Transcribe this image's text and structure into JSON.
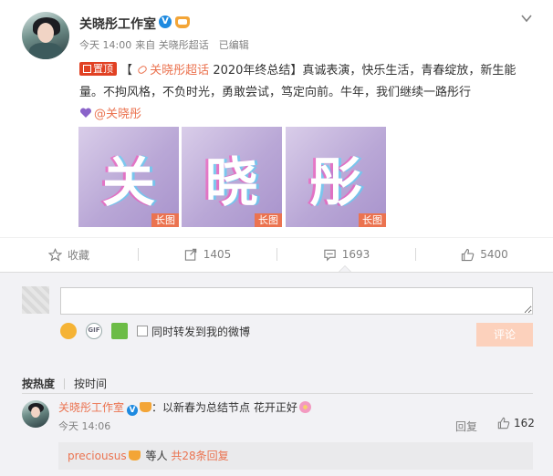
{
  "post": {
    "author": "关晓彤工作室",
    "time": "今天 14:00",
    "source": "来自 关晓彤超话",
    "edited": "已编辑",
    "pin_label": "置顶",
    "bracket_open": "【",
    "topic_link": "关晓彤超话",
    "topic_title": "2020年终总结",
    "text": "】真诚表演，快乐生活，青春绽放，新生能量。不拘风格，不负时光，勇敢尝试，笃定向前。牛年，我们继续一路彤行",
    "mention": "@关晓彤",
    "images": [
      {
        "char": "关",
        "tag": "长图"
      },
      {
        "char": "晓",
        "tag": "长图"
      },
      {
        "char": "彤",
        "tag": "长图"
      }
    ]
  },
  "actions": {
    "favorite": "收藏",
    "repost": "1405",
    "comment": "1693",
    "like": "5400"
  },
  "composer": {
    "input_value": "",
    "forward_label": "同时转发到我的微博",
    "submit_label": "评论"
  },
  "sort": {
    "hot": "按热度",
    "time": "按时间"
  },
  "comment": {
    "author": "关晓彤工作室",
    "text": "：以新春为总结节点 花开正好",
    "time": "今天 14:06",
    "reply_label": "回复",
    "likes": "162",
    "sub_user": "preciousus",
    "sub_text": " 等人",
    "sub_more": "共28条回复"
  },
  "colors": {
    "accent": "#eb7350",
    "pin": "#e14123",
    "verified": "#1e8ae0",
    "submit_disabled": "#fcd1bc"
  }
}
